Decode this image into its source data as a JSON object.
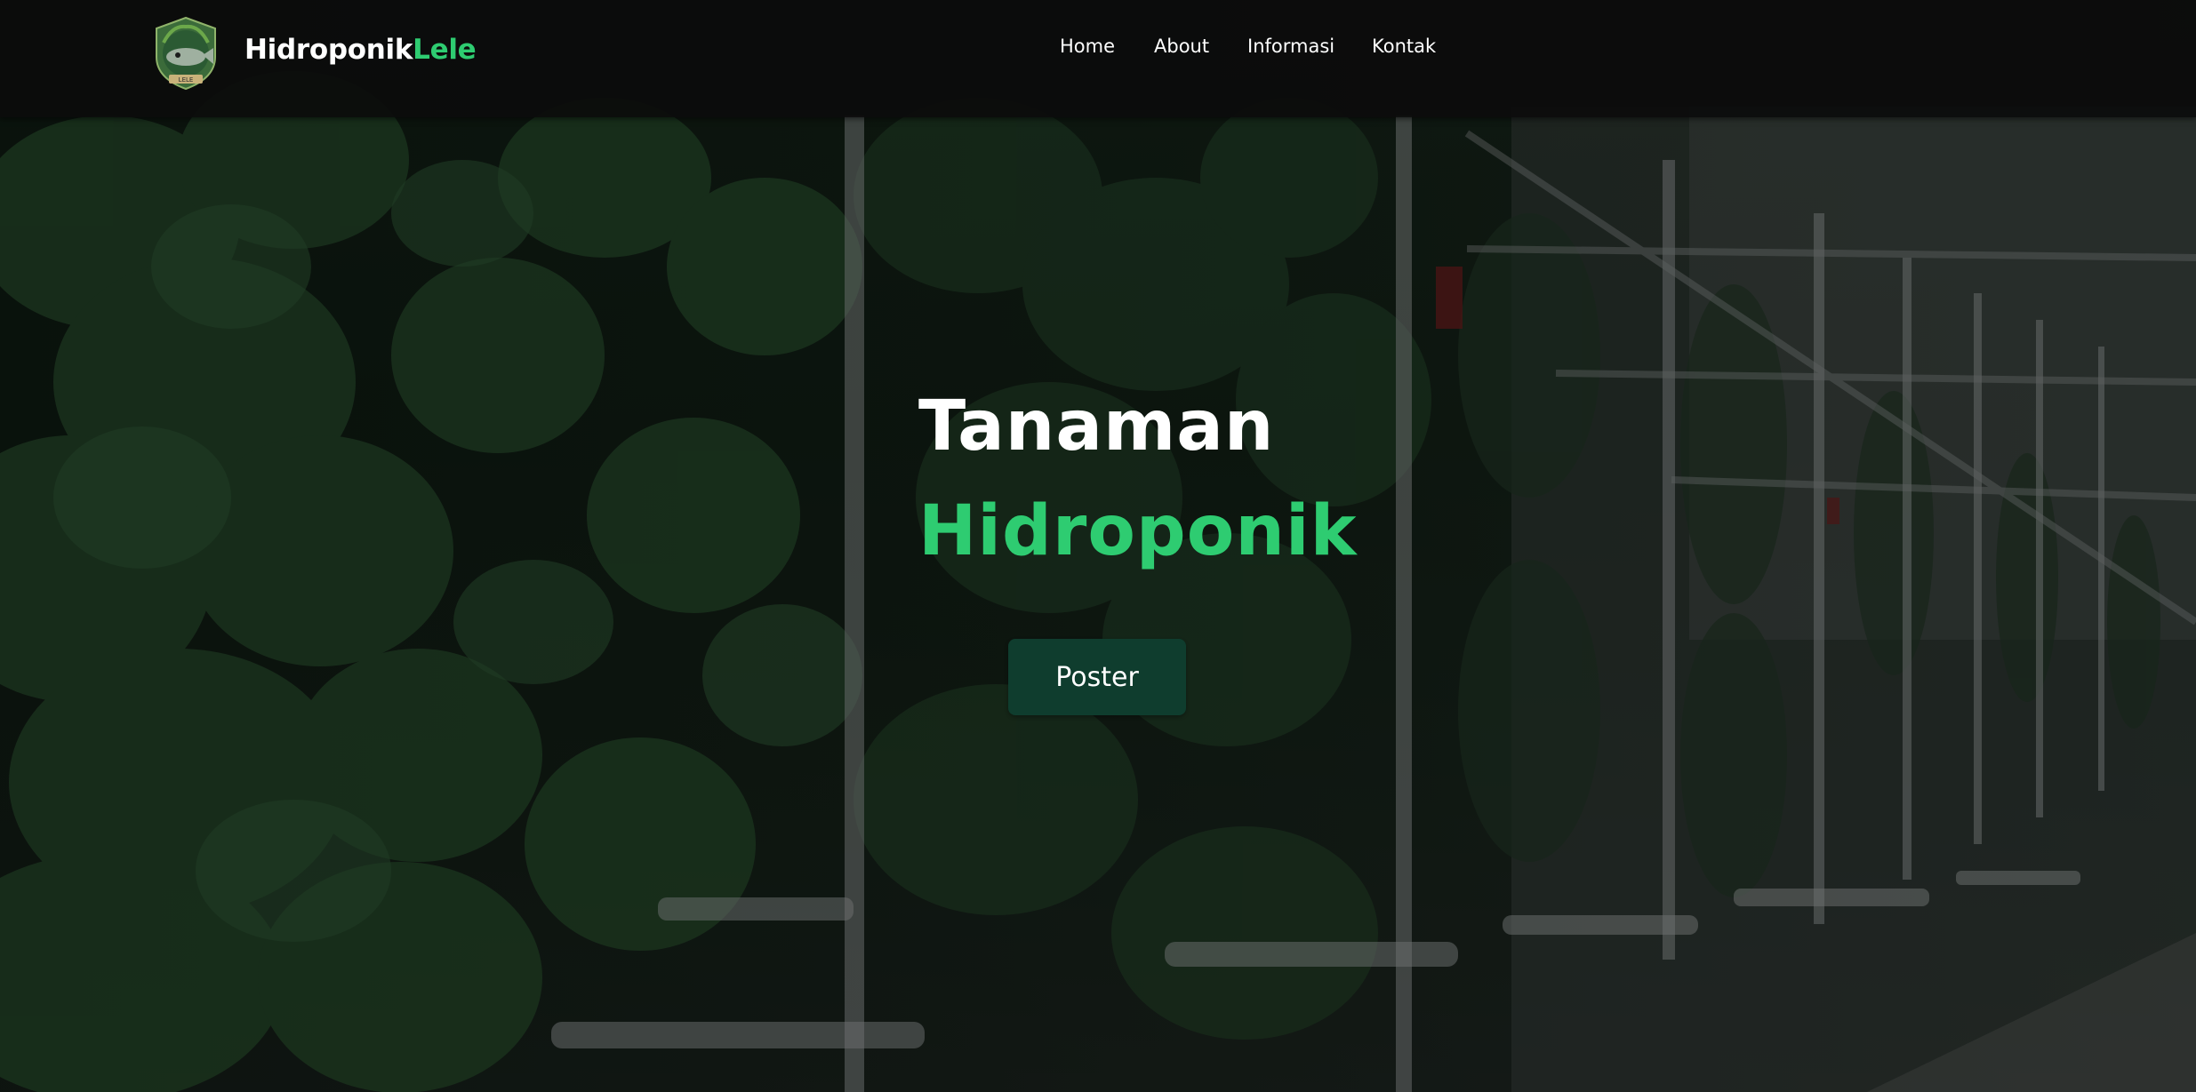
{
  "brand": {
    "name_part1": "Hidroponik",
    "name_part2": "Lele",
    "logo_icon": "catfish-emblem-icon",
    "logo_text": "LELE"
  },
  "nav": {
    "items": [
      {
        "label": "Home"
      },
      {
        "label": "About"
      },
      {
        "label": "Informasi"
      },
      {
        "label": "Kontak"
      }
    ]
  },
  "hero": {
    "title_line1": "Tanaman",
    "title_line2": "Hidroponik",
    "button_label": "Poster",
    "background": "hydroponic-greenhouse-photo"
  },
  "colors": {
    "accent": "#2ecc71",
    "button_bg": "#0f3d2e",
    "navbar_bg": "#0c0c0c"
  }
}
